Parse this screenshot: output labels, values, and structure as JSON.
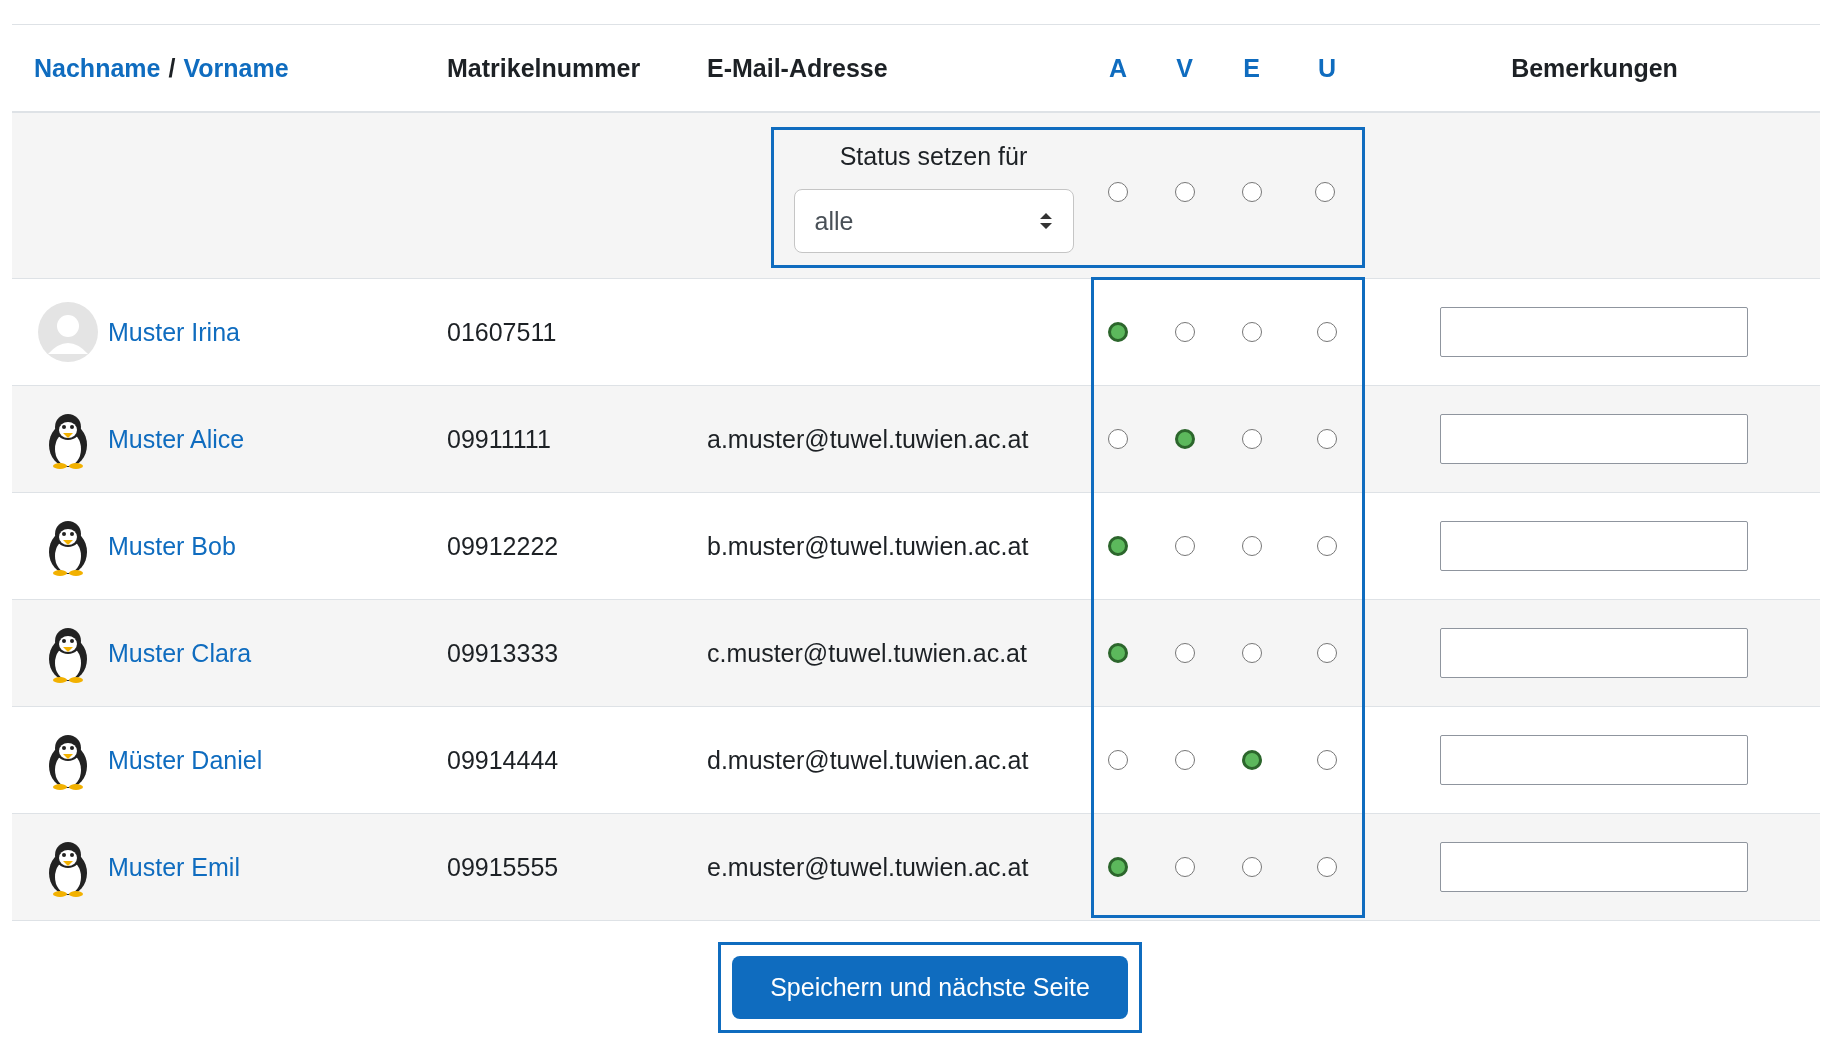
{
  "header": {
    "name_links": [
      "Nachname",
      "Vorname"
    ],
    "name_separator": "/",
    "matrikel": "Matrikelnummer",
    "email": "E-Mail-Adresse",
    "status_links": [
      "A",
      "V",
      "E",
      "U"
    ],
    "remarks": "Bemerkungen"
  },
  "status_row": {
    "label": "Status setzen für",
    "select_value": "alle",
    "options": [
      {
        "selected": false
      },
      {
        "selected": false
      },
      {
        "selected": false
      },
      {
        "selected": false
      }
    ]
  },
  "rows": [
    {
      "name": "Muster Irina",
      "kind": "default_avatar",
      "matrikel": "01607511",
      "status": [
        {
          "selected": true
        },
        {
          "selected": false
        },
        {
          "selected": false
        },
        {
          "selected": false
        }
      ]
    },
    {
      "name": "Muster Alice",
      "kind": "picture_avatar",
      "matrikel": "09911111",
      "email": "a.muster@tuwel.tuwien.ac.at",
      "status": [
        {
          "selected": false
        },
        {
          "selected": true
        },
        {
          "selected": false
        },
        {
          "selected": false
        }
      ]
    },
    {
      "name": "Muster Bob",
      "kind": "picture_avatar",
      "matrikel": "09912222",
      "email": "b.muster@tuwel.tuwien.ac.at",
      "status": [
        {
          "selected": true
        },
        {
          "selected": false
        },
        {
          "selected": false
        },
        {
          "selected": false
        }
      ]
    },
    {
      "name": "Muster Clara",
      "kind": "picture_avatar",
      "matrikel": "09913333",
      "email": "c.muster@tuwel.tuwien.ac.at",
      "status": [
        {
          "selected": true
        },
        {
          "selected": false
        },
        {
          "selected": false
        },
        {
          "selected": false
        }
      ]
    },
    {
      "name": "Müster Daniel",
      "kind": "picture_avatar",
      "matrikel": "09914444",
      "email": "d.muster@tuwel.tuwien.ac.at",
      "status": [
        {
          "selected": false
        },
        {
          "selected": false
        },
        {
          "selected": true
        },
        {
          "selected": false
        }
      ]
    },
    {
      "name": "Muster Emil",
      "kind": "picture_avatar",
      "matrikel": "09915555",
      "email": "e.muster@tuwel.tuwien.ac.at",
      "status": [
        {
          "selected": true
        },
        {
          "selected": false
        },
        {
          "selected": false
        },
        {
          "selected": false
        }
      ]
    }
  ],
  "save_button": "Speichern und nächste Seite"
}
